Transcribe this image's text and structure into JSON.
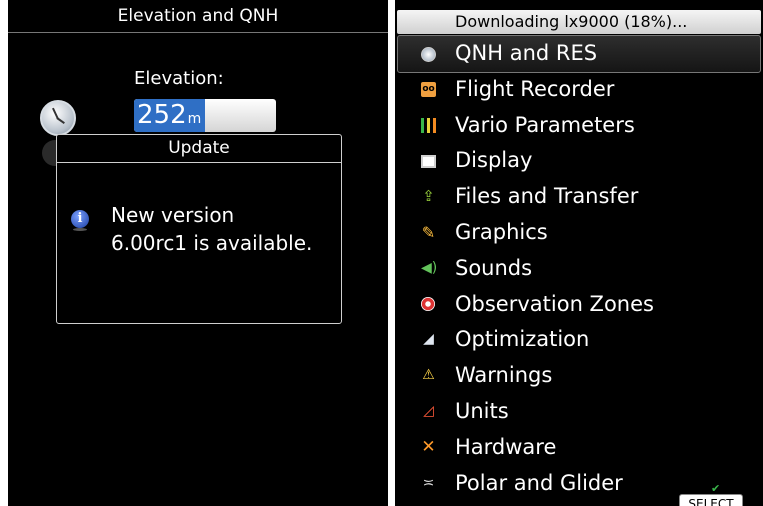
{
  "left": {
    "title": "Elevation and QNH",
    "elevation_label": "Elevation:",
    "elevation_value": "252",
    "elevation_unit": "m",
    "dialog": {
      "title": "Update",
      "message_line1": "New version",
      "message_line2": "6.00rc1 is available."
    }
  },
  "right": {
    "status": "Downloading lx9000 (18%)...",
    "selected_index": 0,
    "menu": [
      {
        "label": "QNH and RES",
        "icon": "qnh-gauge-icon"
      },
      {
        "label": "Flight Recorder",
        "icon": "recorder-icon"
      },
      {
        "label": "Vario Parameters",
        "icon": "vario-bars-icon"
      },
      {
        "label": "Display",
        "icon": "monitor-icon"
      },
      {
        "label": "Files and Transfer",
        "icon": "file-transfer-icon"
      },
      {
        "label": "Graphics",
        "icon": "paintbrush-icon"
      },
      {
        "label": "Sounds",
        "icon": "speaker-icon"
      },
      {
        "label": "Observation Zones",
        "icon": "target-icon"
      },
      {
        "label": "Optimization",
        "icon": "optimization-icon"
      },
      {
        "label": "Warnings",
        "icon": "warning-icon"
      },
      {
        "label": "Units",
        "icon": "ruler-icon"
      },
      {
        "label": "Hardware",
        "icon": "tools-icon"
      },
      {
        "label": "Polar and Glider",
        "icon": "glider-icon"
      }
    ],
    "select_label": "SELECT"
  },
  "colors": {
    "background": "#000000",
    "selection_blue": "#2f6fc5",
    "text": "#ffffff"
  }
}
